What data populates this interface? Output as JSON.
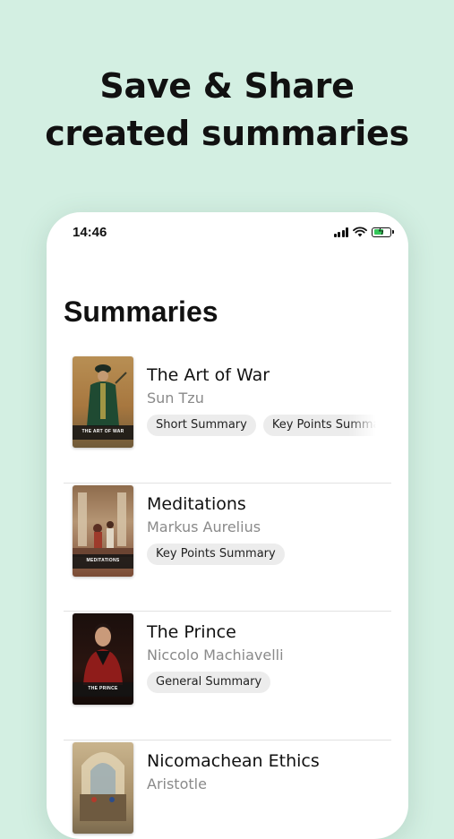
{
  "headline": {
    "line1": "Save & Share",
    "line2": "created summaries"
  },
  "status_bar": {
    "time": "14:46",
    "icons": [
      "signal-icon",
      "wifi-icon",
      "battery-charging-icon"
    ]
  },
  "screen": {
    "title": "Summaries"
  },
  "books": [
    {
      "title": "The Art of War",
      "author": "Sun Tzu",
      "cover_text": "THE ART OF WAR",
      "tags": [
        "Short Summary",
        "Key Points Summary"
      ]
    },
    {
      "title": "Meditations",
      "author": "Markus Aurelius",
      "cover_text": "MEDITATIONS",
      "tags": [
        "Key Points Summary"
      ]
    },
    {
      "title": "The Prince",
      "author": "Niccolo Machiavelli",
      "cover_text": "THE PRINCE",
      "tags": [
        "General Summary"
      ]
    },
    {
      "title": "Nicomachean Ethics",
      "author": "Aristotle",
      "cover_text": "",
      "tags": []
    }
  ],
  "colors": {
    "background": "#d3efe2",
    "card": "#ffffff",
    "tag_bg": "#ececec",
    "author_gray": "#8a8a8a",
    "battery_green": "#34c759"
  }
}
